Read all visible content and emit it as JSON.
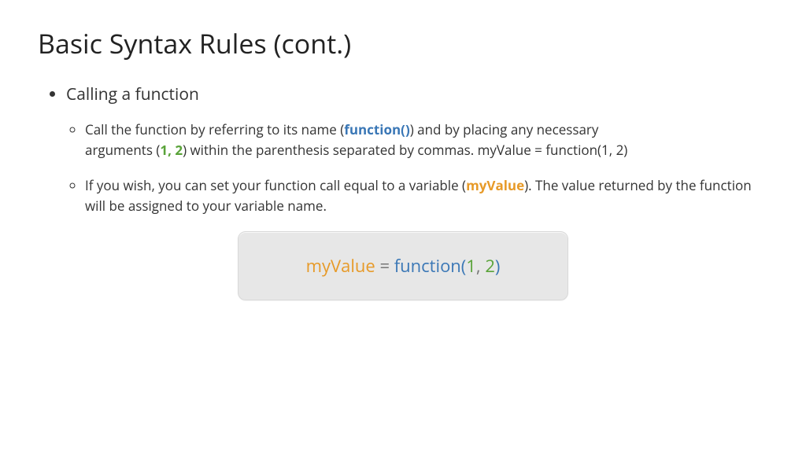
{
  "title": "Basic Syntax Rules (cont.)",
  "bullet1": "Calling a function",
  "sub1": {
    "t1": "Call the function by referring to its name (",
    "func": "function()",
    "t2": ") and by placing any necessary arguments (",
    "args": "1, 2",
    "t3": ") within the parenthesis separated by commas. myValue = function(1, 2)"
  },
  "sub2": {
    "t1": "If you wish, you can set your function call equal to a variable (",
    "var": "myValue",
    "t2": "). The value returned by the function will be assigned to your variable name."
  },
  "code": {
    "var": "myValue",
    "eq": " = ",
    "func": "function",
    "open": "(",
    "arg1": "1",
    "comma": ", ",
    "arg2": "2",
    "close": ")"
  }
}
